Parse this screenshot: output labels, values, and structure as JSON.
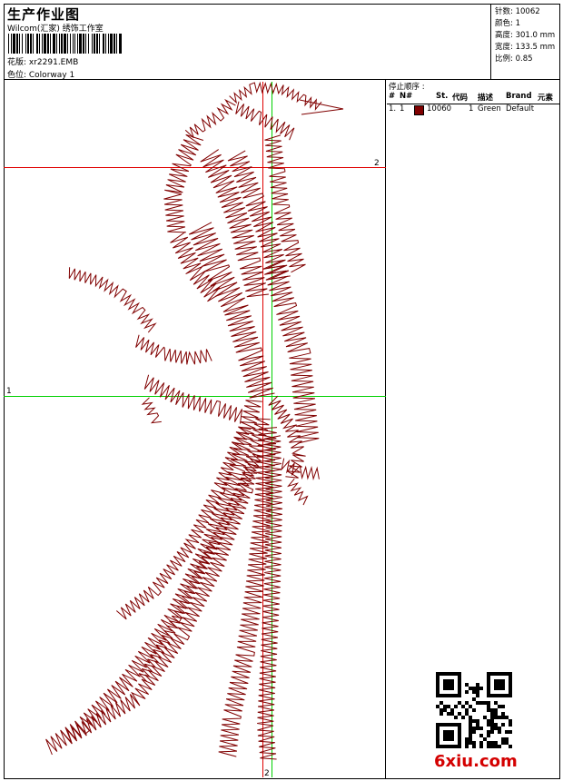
{
  "header": {
    "title": "生产作业图",
    "company": "Wilcom(汇家) 绣饰工作室",
    "design_label": "花版: xr2291.EMB",
    "colorway_label": "色位: Colorway 1"
  },
  "stats": [
    {
      "label": "针数",
      "value": "10062"
    },
    {
      "label": "颜色",
      "value": "1"
    },
    {
      "label": "高度",
      "value": "301.0 mm"
    },
    {
      "label": "宽度",
      "value": "133.5 mm"
    },
    {
      "label": "比例",
      "value": "0.85"
    }
  ],
  "sequence": {
    "title": "停止顺序 :",
    "columns": [
      "#",
      "N#",
      "St.",
      "代码",
      "描述",
      "Brand",
      "元素"
    ],
    "rows": [
      {
        "num": "1.",
        "n": "1",
        "stitches": "10060",
        "code": "1",
        "description": "Green",
        "brand": "Default",
        "color": "#800000"
      }
    ]
  },
  "guides": {
    "horizontal_label": "2",
    "vertical_label": "2",
    "green_label": "1"
  },
  "watermark": "6xiu.com",
  "colors": {
    "thread": "#800000",
    "guide_red": "#e00000",
    "guide_green": "#00d000"
  }
}
